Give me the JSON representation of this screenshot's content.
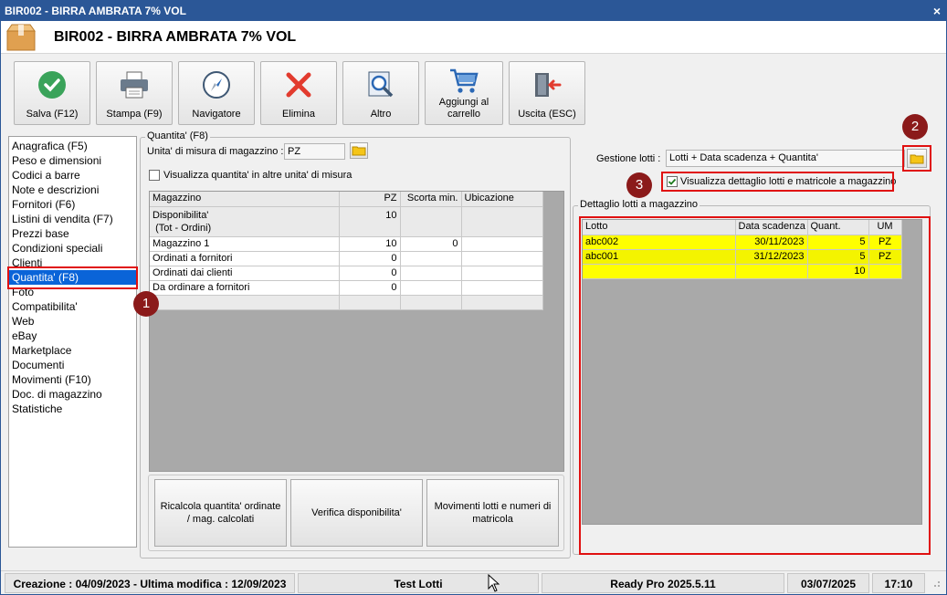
{
  "window": {
    "title": "BIR002 - BIRRA AMBRATA 7% VOL",
    "close_glyph": "×",
    "header_title": "BIR002 - BIRRA AMBRATA 7% VOL"
  },
  "toolbar": {
    "save": "Salva (F12)",
    "print": "Stampa (F9)",
    "navigator": "Navigatore",
    "delete": "Elimina",
    "other": "Altro",
    "add_to_cart": "Aggiungi al carrello",
    "exit": "Uscita (ESC)"
  },
  "nav": {
    "items": [
      "Anagrafica (F5)",
      "Peso e dimensioni",
      "Codici a barre",
      "Note e descrizioni",
      "Fornitori (F6)",
      "Listini di vendita (F7)",
      "Prezzi base",
      "Condizioni speciali",
      "Clienti",
      "Quantita' (F8)",
      "Foto",
      "Compatibilita'",
      "Web",
      "eBay",
      "Marketplace",
      "Documenti",
      "Movimenti (F10)",
      "Doc. di magazzino",
      "Statistiche"
    ],
    "selected": "Quantita' (F8)"
  },
  "quantity": {
    "group_title": "Quantita' (F8)",
    "um_label": "Unita' di misura di magazzino :",
    "um_value": "PZ",
    "show_other_units_label": "Visualizza quantita' in altre unita' di misura",
    "grid": {
      "headers": [
        "Magazzino",
        "PZ",
        "Scorta min.",
        "Ubicazione"
      ],
      "rows": [
        {
          "name": "Disponibilita'",
          "sub": "(Tot - Ordini)",
          "pz": "10",
          "min": "",
          "loc": ""
        },
        {
          "name": "Magazzino 1",
          "pz": "10",
          "min": "0",
          "loc": ""
        },
        {
          "name": "Ordinati a fornitori",
          "pz": "0",
          "min": "",
          "loc": ""
        },
        {
          "name": "Ordinati dai clienti",
          "pz": "0",
          "min": "",
          "loc": ""
        },
        {
          "name": "Da ordinare a fornitori",
          "pz": "0",
          "min": "",
          "loc": ""
        }
      ]
    },
    "buttons": {
      "recalc": "Ricalcola quantita' ordinate / mag. calcolati",
      "verify": "Verifica disponibilita'",
      "movements": "Movimenti lotti e numeri di matricola"
    }
  },
  "lots": {
    "management_label": "Gestione lotti :",
    "management_value": "Lotti + Data scadenza + Quantita'",
    "show_detail_label": "Visualizza dettaglio lotti e matricole a magazzino",
    "show_detail_checked": true,
    "group_title": "Dettaglio lotti a magazzino",
    "grid": {
      "headers": [
        "Lotto",
        "Data scadenza",
        "Quant.",
        "UM"
      ],
      "rows": [
        {
          "lot": "abc002",
          "date": "30/11/2023",
          "qty": "5",
          "um": "PZ"
        },
        {
          "lot": "abc001",
          "date": "31/12/2023",
          "qty": "5",
          "um": "PZ"
        }
      ],
      "total": "10"
    }
  },
  "badges": [
    "1",
    "2",
    "3"
  ],
  "status": {
    "dates": "Creazione : 04/09/2023 - Ultima modifica : 12/09/2023",
    "company": "Test Lotti",
    "version": "Ready Pro 2025.5.11",
    "date": "03/07/2025",
    "time": "17:10"
  },
  "colors": {
    "titlebar": "#2b5797",
    "selection": "#0a64d8",
    "highlight": "#ffff00",
    "annotation": "#e01010",
    "badge": "#8b1a1a"
  }
}
